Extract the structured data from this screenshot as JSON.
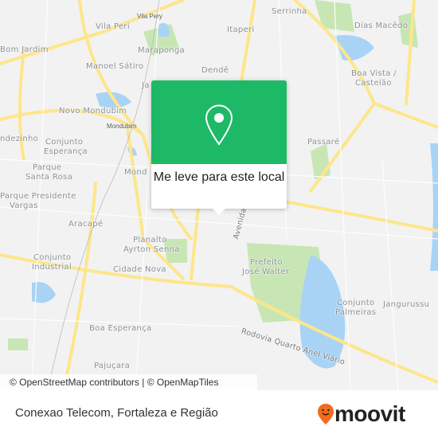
{
  "map": {
    "labels": [
      {
        "text": "Serrinha"
      },
      {
        "text": "Vila Pery"
      },
      {
        "text": "Vila Peri"
      },
      {
        "text": "Itaperi"
      },
      {
        "text": "Dias Macêdo"
      },
      {
        "text": "Bom Jardim"
      },
      {
        "text": "Maraponga"
      },
      {
        "text": "Manoel Sátiro"
      },
      {
        "text": "Dendê"
      },
      {
        "text": "Boa Vista /"
      },
      {
        "text": "Castelão"
      },
      {
        "text": "Novo Mondubim"
      },
      {
        "text": "Mondubim"
      },
      {
        "text": "Passaré"
      },
      {
        "text": "ndezinho"
      },
      {
        "text": "Conjunto"
      },
      {
        "text": "Esperança"
      },
      {
        "text": "Parque"
      },
      {
        "text": "Santa Rosa"
      },
      {
        "text": "Parque Presidente"
      },
      {
        "text": "Vargas"
      },
      {
        "text": "Aracapé"
      },
      {
        "text": "Planalto"
      },
      {
        "text": "Ayrton Senna"
      },
      {
        "text": "Conjunto"
      },
      {
        "text": "Industrial"
      },
      {
        "text": "Cidade Nova"
      },
      {
        "text": "Prefeito"
      },
      {
        "text": "José Walter"
      },
      {
        "text": "Conjunto"
      },
      {
        "text": "Palmeiras"
      },
      {
        "text": "Jangurussu"
      },
      {
        "text": "Boa Esperança"
      },
      {
        "text": "Pajuçara"
      },
      {
        "text": "Avenida"
      },
      {
        "text": "Rodovia Quarto Anel Viário"
      },
      {
        "text": "Mond"
      },
      {
        "text": "Ja"
      }
    ],
    "colors": {
      "background": "#f2f2f2",
      "road": "#fde68a",
      "water": "#a9d3f5",
      "park": "#c8e6b4",
      "accent": "#1eb966"
    }
  },
  "popup": {
    "label": "Me leve para este local",
    "icon": "map-pin-icon"
  },
  "attribution": "© OpenStreetMap contributors | © OpenMapTiles",
  "footer": {
    "title": "Conexao Telecom, Fortaleza e Região",
    "logo": "moovit",
    "logo_color": "#f26a1b"
  }
}
